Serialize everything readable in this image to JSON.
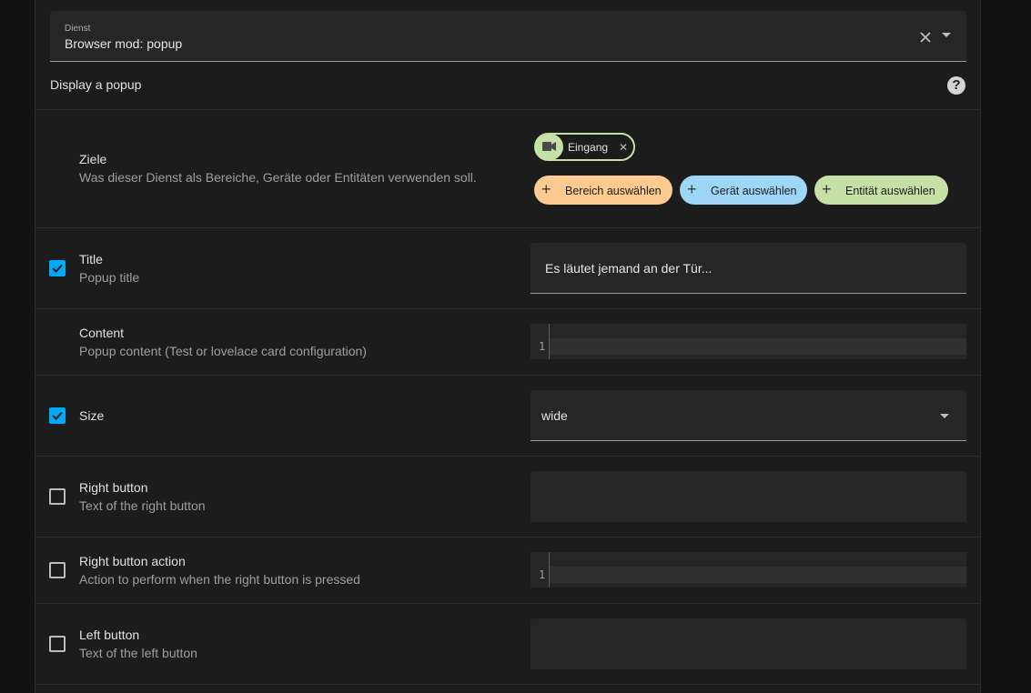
{
  "service": {
    "label": "Dienst",
    "value": "Browser mod: popup",
    "description": "Display a popup"
  },
  "targets": {
    "title": "Ziele",
    "subtitle": "Was dieser Dienst als Bereiche, Geräte oder Entitäten verwenden soll.",
    "selected_entity": "Eingang",
    "add_area_label": "Bereich auswählen",
    "add_device_label": "Gerät auswählen",
    "add_entity_label": "Entität auswählen",
    "colors": {
      "area": "#fdca8f",
      "device": "#9ed6f8",
      "entity": "#c5e1a5"
    }
  },
  "fields": {
    "title": {
      "label": "Title",
      "description": "Popup title",
      "checked": true,
      "value": "Es läutet jemand an der Tür..."
    },
    "content": {
      "label": "Content",
      "description": "Popup content (Test or lovelace card configuration)",
      "line_number": "1"
    },
    "size": {
      "label": "Size",
      "checked": true,
      "value": "wide"
    },
    "right_button": {
      "label": "Right button",
      "description": "Text of the right button",
      "checked": false
    },
    "right_button_action": {
      "label": "Right button action",
      "description": "Action to perform when the right button is pressed",
      "checked": false,
      "line_number": "1"
    },
    "left_button": {
      "label": "Left button",
      "description": "Text of the left button",
      "checked": false
    }
  },
  "accent_color": "#03a9f4"
}
